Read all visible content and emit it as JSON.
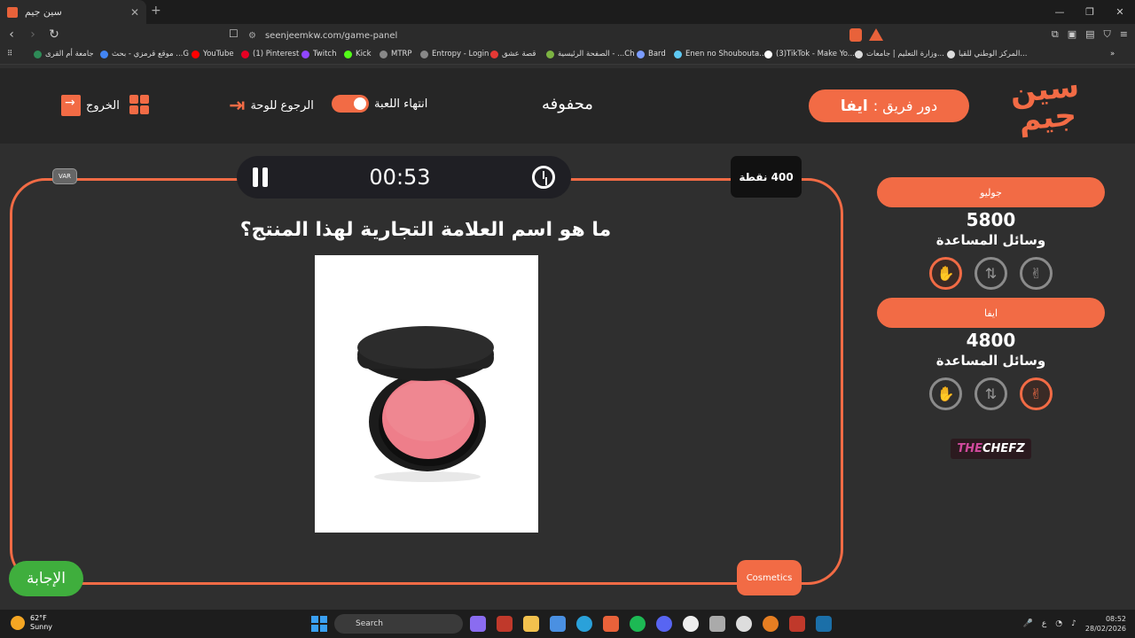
{
  "browser": {
    "tab_title": "سين جيم",
    "tab_close": "✕",
    "new_tab": "+",
    "window_controls": [
      "—",
      "❐",
      "✕"
    ],
    "url": "seenjeemkw.com/game-panel",
    "bookmarks": [
      {
        "label": "جامعة أم القرى",
        "color": "#2e8b57"
      },
      {
        "label": "موقع قرمزي - بحث ...G",
        "color": "#4285f4"
      },
      {
        "label": "YouTube",
        "color": "#ff0000"
      },
      {
        "label": "(1) Pinterest",
        "color": "#e60023"
      },
      {
        "label": "Twitch",
        "color": "#9146ff"
      },
      {
        "label": "Kick",
        "color": "#53fc18"
      },
      {
        "label": "MTRP",
        "color": "#888888"
      },
      {
        "label": "Entropy - Login",
        "color": "#888888"
      },
      {
        "label": "قصة عشق",
        "color": "#e53935"
      },
      {
        "label": "الصفحة الرئيسية - ...Ch",
        "color": "#7cb342"
      },
      {
        "label": "Bard",
        "color": "#7b9cff"
      },
      {
        "label": "Enen no Shouboutа...",
        "color": "#5ec8f2"
      },
      {
        "label": "(3)TikTok - Make Yo...",
        "color": "#ffffff"
      },
      {
        "label": "وزارة التعليم | جامعات...",
        "color": "#dddddd"
      },
      {
        "label": "المركز الوطني للقيا...",
        "color": "#dddddd"
      }
    ]
  },
  "header": {
    "turn_label": "دور فريق :",
    "turn_team": "ايفا",
    "topic": "محفوفه",
    "end_game": "انتهاء اللعبة",
    "back_to_board": "الرجوع للوحة",
    "exit": "الخروج",
    "logo_text": "سين جيم"
  },
  "question": {
    "timer": "00:53",
    "points": "400 نقطة",
    "var_label": "VAR",
    "text": "ما هو اسم العلامة التجارية لهذا المنتج؟",
    "answer_button": "الإجابة",
    "category": "Cosmetics"
  },
  "teams": [
    {
      "name": "جوليو",
      "score": "5800",
      "aids_label": "وسائل المساعدة",
      "active_aid": "hand"
    },
    {
      "name": "ايفا",
      "score": "4800",
      "aids_label": "وسائل المساعدة",
      "active_aid": "peace"
    }
  ],
  "sponsor": {
    "part1": "THE",
    "part2": "CHEFZ"
  },
  "taskbar": {
    "temp": "62°F",
    "condition": "Sunny",
    "search_placeholder": "Search",
    "lang": "ع",
    "time": "08:52",
    "date": "28/02/2026"
  },
  "colors": {
    "accent": "#f26b45",
    "answer_green": "#3fae3d",
    "bg": "#2f2f2f"
  }
}
